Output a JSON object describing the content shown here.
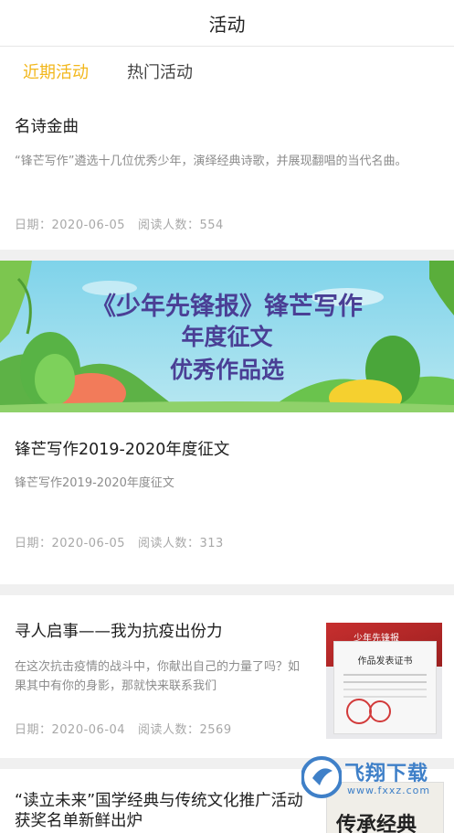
{
  "header": {
    "title": "活动"
  },
  "tabs": [
    {
      "label": "近期活动",
      "active": true
    },
    {
      "label": "热门活动",
      "active": false
    }
  ],
  "colors": {
    "accent": "#f2b71b",
    "banner_text": "#4a3f95",
    "watermark": "#3f80c8"
  },
  "activities": [
    {
      "title": "名诗金曲",
      "description": "“锋芒写作”遴选十几位优秀少年，演绎经典诗歌，并展现翻唱的当代名曲。",
      "date_label": "日期：",
      "date": "2020-06-05",
      "reads_label": "阅读人数：",
      "reads": "554"
    },
    {
      "banner": {
        "line1": "《少年先锋报》锋芒写作",
        "line2": "年度征文",
        "line3": "优秀作品选"
      },
      "title": "锋芒写作2019-2020年度征文",
      "description": "锋芒写作2019-2020年度征文",
      "date_label": "日期：",
      "date": "2020-06-05",
      "reads_label": "阅读人数：",
      "reads": "313"
    },
    {
      "title": "寻人启事——我为抗疫出份力",
      "description": "在这次抗击疫情的战斗中，你献出自己的力量了吗？如果其中有你的身影，那就快来联系我们",
      "date_label": "日期：",
      "date": "2020-06-04",
      "reads_label": "阅读人数：",
      "reads": "2569",
      "thumbnail": {
        "heading": "作品发表证书",
        "masthead": "少年先锋报"
      }
    },
    {
      "title": "“读立未来”国学经典与传统文化推广活动获奖名单新鲜出炉",
      "thumbnail": {
        "heading": "传承经典"
      }
    }
  ],
  "watermark": {
    "text": "飞翔下载",
    "url": "www.fxxz.com"
  }
}
